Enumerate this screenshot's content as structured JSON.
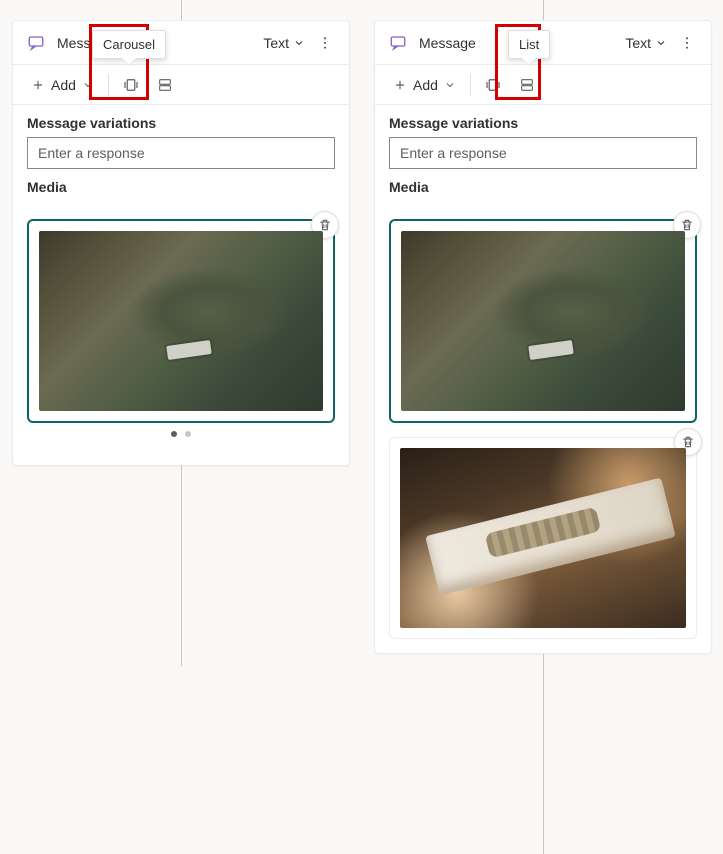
{
  "left": {
    "title": "Message",
    "tooltip": "Carousel",
    "text_dd": "Text",
    "add_label": "Add",
    "variations_label": "Message variations",
    "response_placeholder": "Enter a response",
    "media_label": "Media",
    "layout_mode": "carousel",
    "pager": {
      "count": 2,
      "active": 0
    }
  },
  "right": {
    "title": "Message",
    "tooltip": "List",
    "text_dd": "Text",
    "add_label": "Add",
    "variations_label": "Message variations",
    "response_placeholder": "Enter a response",
    "media_label": "Media",
    "layout_mode": "list"
  }
}
